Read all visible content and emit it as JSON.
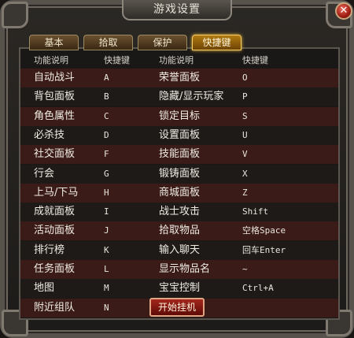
{
  "window": {
    "title": "游戏设置",
    "close_glyph": "✕"
  },
  "tabs": [
    {
      "label": "基本",
      "active": false
    },
    {
      "label": "拾取",
      "active": false
    },
    {
      "label": "保护",
      "active": false
    },
    {
      "label": "快捷键",
      "active": true
    }
  ],
  "table": {
    "headers": [
      "功能说明",
      "快捷键",
      "功能说明",
      "快捷键"
    ],
    "rows": [
      [
        "自动战斗",
        "A",
        "荣誉面板",
        "O"
      ],
      [
        "背包面板",
        "B",
        "隐藏/显示玩家",
        "P"
      ],
      [
        "角色属性",
        "C",
        "锁定目标",
        "S"
      ],
      [
        "必杀技",
        "D",
        "设置面板",
        "U"
      ],
      [
        "社交面板",
        "F",
        "技能面板",
        "V"
      ],
      [
        "行会",
        "G",
        "锻铸面板",
        "X"
      ],
      [
        "上马/下马",
        "H",
        "商城面板",
        "Z"
      ],
      [
        "成就面板",
        "I",
        "战士攻击",
        "Shift"
      ],
      [
        "活动面板",
        "J",
        "拾取物品",
        "空格Space"
      ],
      [
        "排行榜",
        "K",
        "输入聊天",
        "回车Enter"
      ],
      [
        "任务面板",
        "L",
        "显示物品名",
        "~"
      ],
      [
        "地图",
        "M",
        "宝宝控制",
        "Ctrl+A"
      ],
      [
        "附近组队",
        "N",
        "",
        ""
      ]
    ]
  },
  "afk_button": {
    "label": "开始挂机"
  },
  "colors": {
    "row_alt": "#3a1b18",
    "tab_active": "#b27a12",
    "button_red": "#a3271c"
  }
}
